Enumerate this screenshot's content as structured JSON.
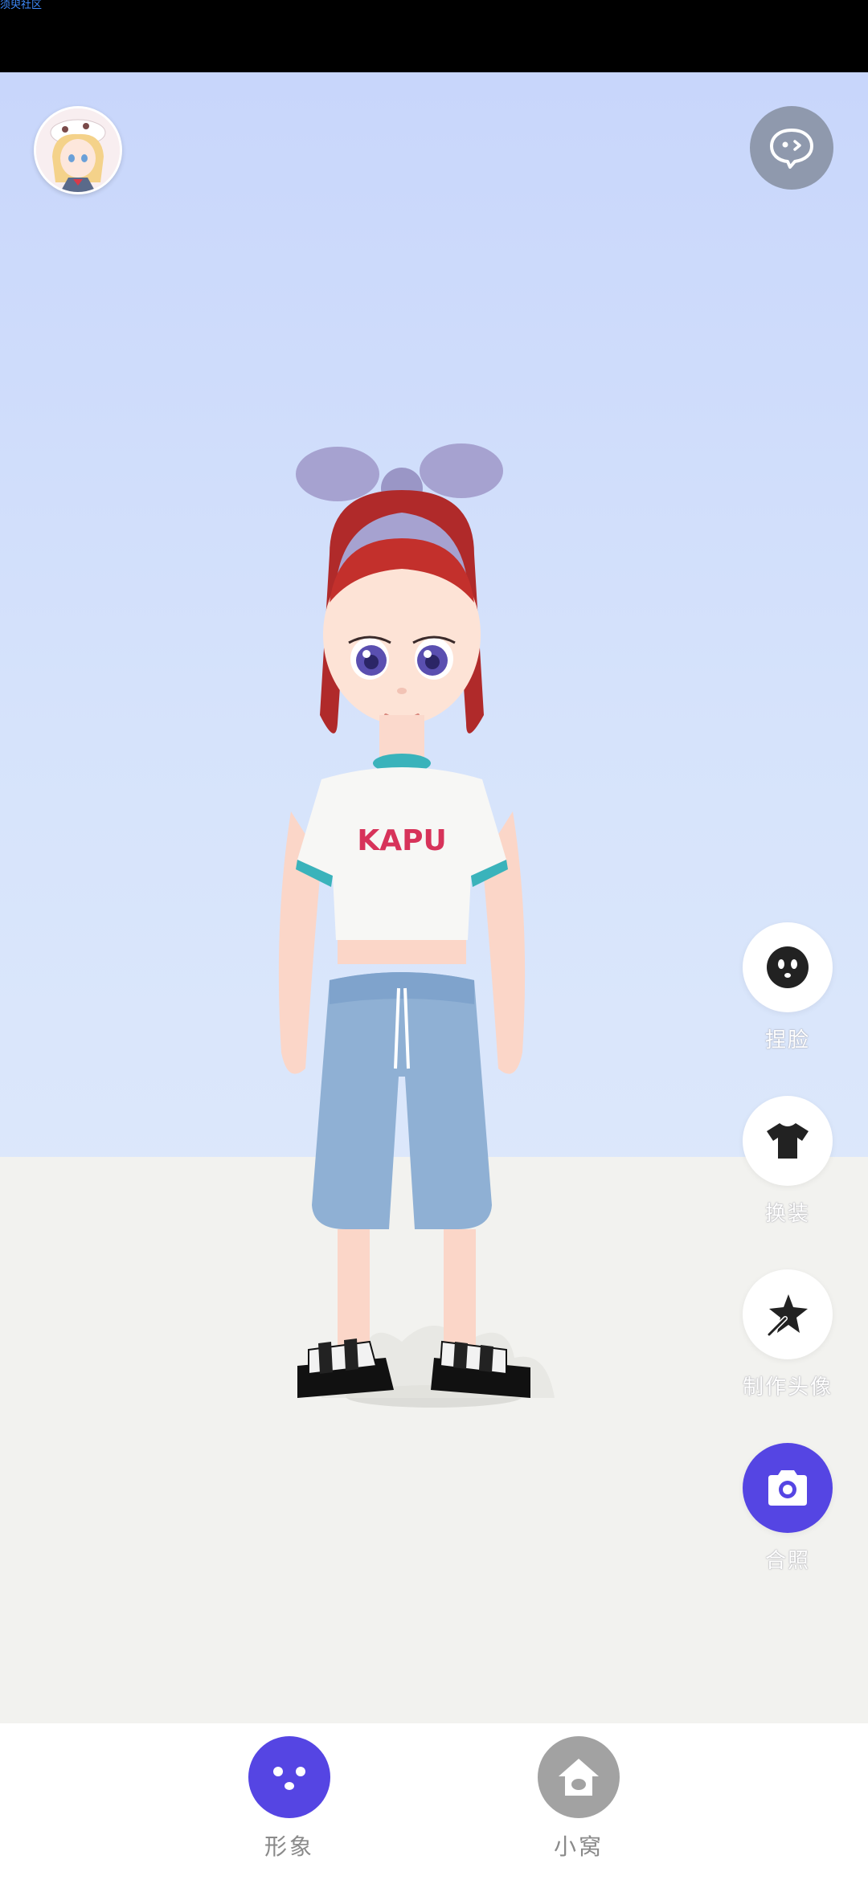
{
  "status_bar": {
    "text": "须臾社区"
  },
  "colors": {
    "accent": "#5545e3",
    "chat_button": "#8f99ad",
    "tab_inactive": "#a2a2a2",
    "sky": "#d6e3fb",
    "floor": "#f2f2ef"
  },
  "header": {
    "avatar_icon": "user-avatar",
    "chat_icon": "speech-bubble-icon"
  },
  "character": {
    "shirt_text": "KAPU"
  },
  "side_actions": [
    {
      "label": "捏脸",
      "icon": "face-icon"
    },
    {
      "label": "换装",
      "icon": "tshirt-icon"
    },
    {
      "label": "制作头像",
      "icon": "magic-wand-star-icon"
    },
    {
      "label": "合照",
      "icon": "camera-icon"
    }
  ],
  "bottom_nav": {
    "tabs": [
      {
        "label": "形象",
        "icon": "avatar-face-icon",
        "active": true
      },
      {
        "label": "小窝",
        "icon": "home-icon",
        "active": false
      }
    ]
  }
}
